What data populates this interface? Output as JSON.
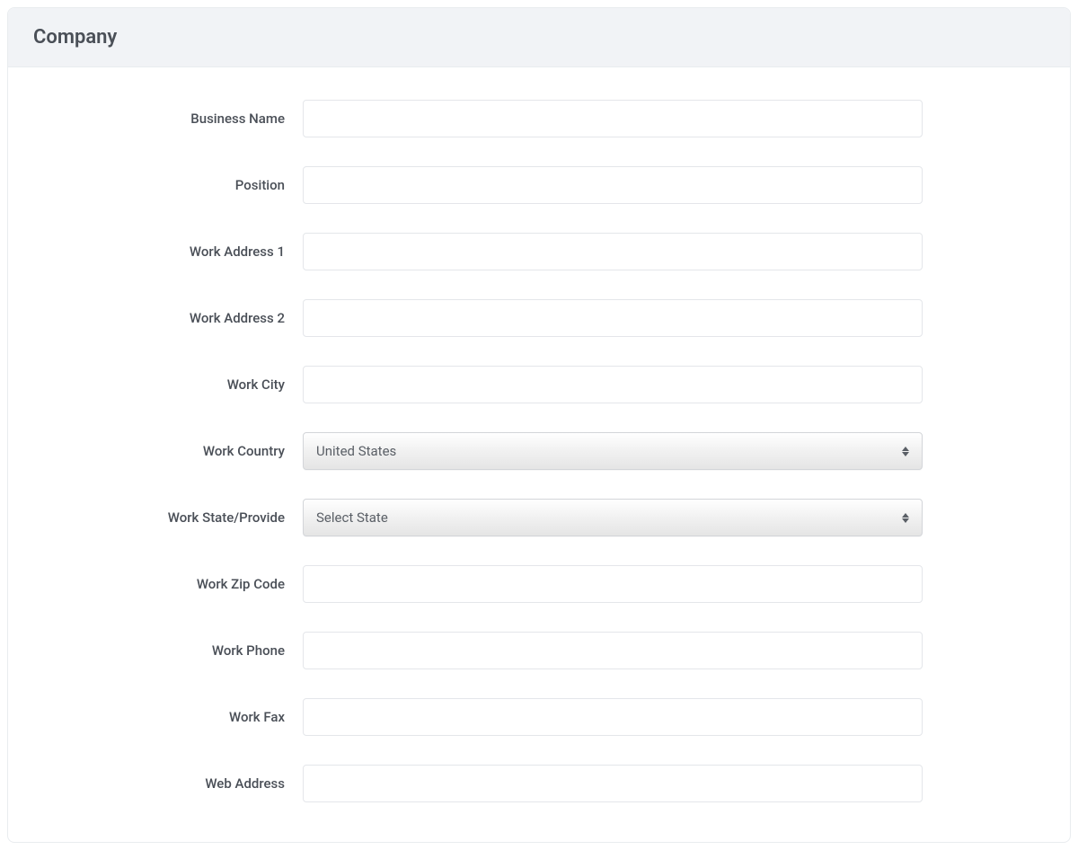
{
  "header": {
    "title": "Company"
  },
  "fields": {
    "business_name": {
      "label": "Business Name",
      "value": ""
    },
    "position": {
      "label": "Position",
      "value": ""
    },
    "work_address_1": {
      "label": "Work Address 1",
      "value": ""
    },
    "work_address_2": {
      "label": "Work Address 2",
      "value": ""
    },
    "work_city": {
      "label": "Work City",
      "value": ""
    },
    "work_country": {
      "label": "Work Country",
      "selected": "United States"
    },
    "work_state": {
      "label": "Work State/Provide",
      "selected": "Select State"
    },
    "work_zip": {
      "label": "Work Zip Code",
      "value": ""
    },
    "work_phone": {
      "label": "Work Phone",
      "value": ""
    },
    "work_fax": {
      "label": "Work Fax",
      "value": ""
    },
    "web_address": {
      "label": "Web Address",
      "value": ""
    }
  }
}
